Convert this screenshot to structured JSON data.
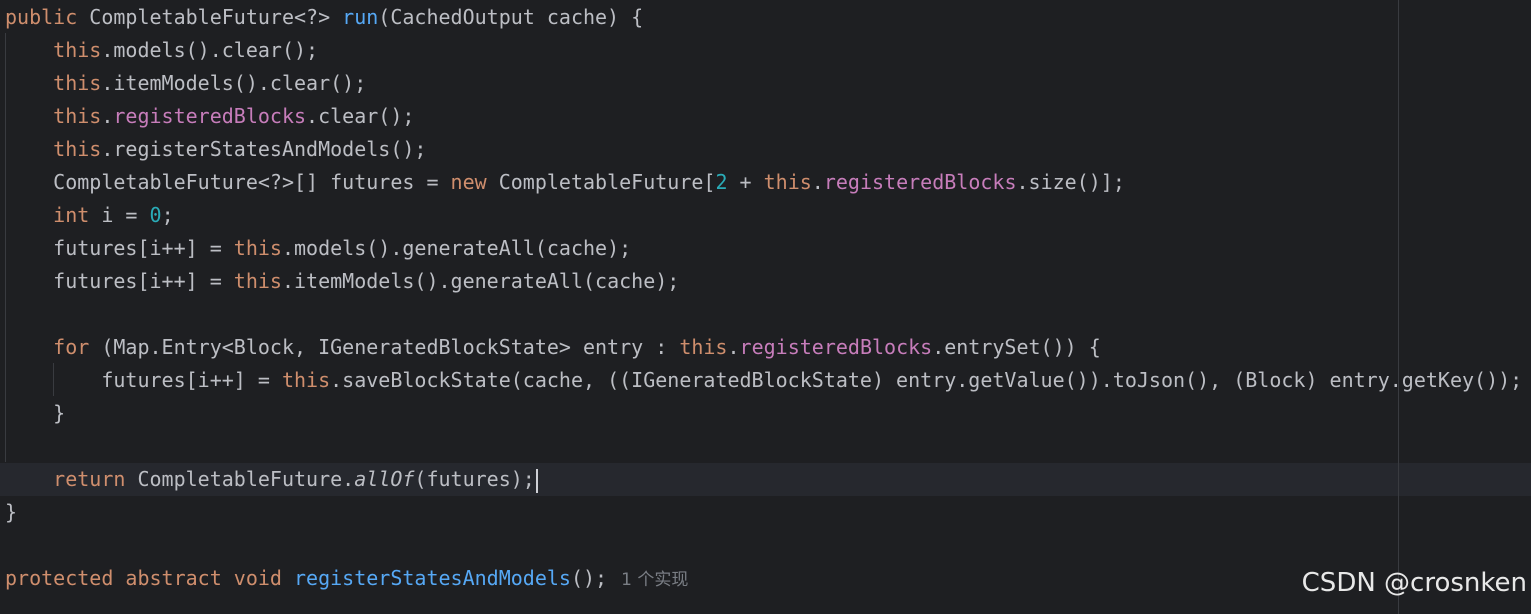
{
  "colors": {
    "background": "#1e1f22",
    "text": "#bcbec4",
    "keyword": "#cf8e6d",
    "method_decl": "#56a8f5",
    "field": "#c77dbb",
    "number": "#2aacb8",
    "hint": "#7a7e85"
  },
  "code": {
    "l1": {
      "kw_public": "public",
      "type": " CompletableFuture<?> ",
      "fn_name": "run",
      "params": "(CachedOutput cache) {"
    },
    "l2": {
      "this": "this",
      "rest": ".models().clear();"
    },
    "l3": {
      "this": "this",
      "rest": ".itemModels().clear();"
    },
    "l4": {
      "this": "this",
      "dot": ".",
      "field": "registeredBlocks",
      "rest": ".clear();"
    },
    "l5": {
      "this": "this",
      "rest": ".registerStatesAndModels();"
    },
    "l6": {
      "a": "CompletableFuture<?>[] futures = ",
      "kw_new": "new",
      "b": " CompletableFuture[",
      "num": "2",
      "c": " + ",
      "this": "this",
      "dot": ".",
      "field": "registeredBlocks",
      "d": ".size()];"
    },
    "l7": {
      "kw_int": "int",
      "a": " i = ",
      "num": "0",
      "b": ";"
    },
    "l8": {
      "a": "futures[i++] = ",
      "this": "this",
      "b": ".models().generateAll(cache);"
    },
    "l9": {
      "a": "futures[i++] = ",
      "this": "this",
      "b": ".itemModels().generateAll(cache);"
    },
    "l11": {
      "kw_for": "for",
      "a": " (Map.Entry<Block, IGeneratedBlockState> entry : ",
      "this": "this",
      "dot": ".",
      "field": "registeredBlocks",
      "b": ".entrySet()) {"
    },
    "l12": {
      "a": "futures[i++] = ",
      "this": "this",
      "b": ".saveBlockState(cache, ((IGeneratedBlockState) entry.getValue()).toJson(), (Block) entry.getKey());"
    },
    "l13": {
      "text": "}"
    },
    "l15": {
      "kw_return": "return",
      "a": " CompletableFuture.",
      "method": "allOf",
      "b": "(futures);"
    },
    "l16": {
      "text": "}"
    },
    "l18": {
      "kw_protected": "protected",
      "kw_abstract": "abstract",
      "kw_void": "void",
      "fn_name": "registerStatesAndModels",
      "b": "();",
      "hint": "1 个实现"
    }
  },
  "watermark": "CSDN @crosnken"
}
